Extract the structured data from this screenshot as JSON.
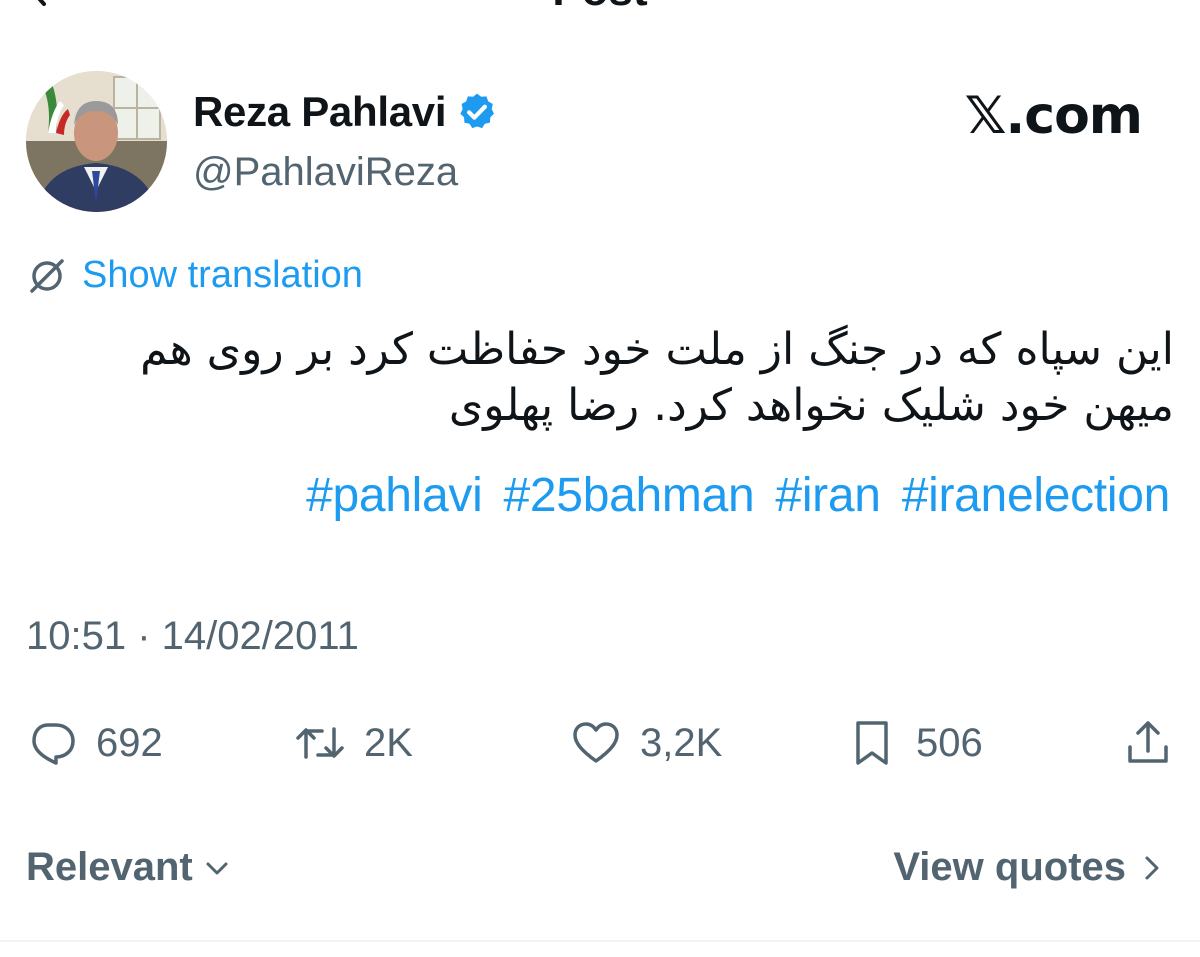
{
  "header": {
    "title": "Post"
  },
  "author": {
    "display_name": "Reza Pahlavi",
    "handle": "@PahlaviReza",
    "verified": true
  },
  "brand": {
    "label": "𝕏.com"
  },
  "translation": {
    "label": "Show translation"
  },
  "tweet": {
    "lines": [
      "این سپاه که در جنگ از ملت خود حفاظت کرد بر روی هم",
      "میهن خود شلیک نخواهد کرد.  رضا پهلوی"
    ],
    "hashtags": [
      "#pahlavi",
      "#25bahman",
      "#iran",
      "#iranelection"
    ]
  },
  "timestamp": "10:51 · 14/02/2011",
  "actions": {
    "replies": "692",
    "reposts": "2K",
    "likes": "3,2K",
    "bookmarks": "506"
  },
  "footer": {
    "sort_label": "Relevant",
    "quotes_label": "View quotes"
  },
  "colors": {
    "accent": "#1d9bf0",
    "muted": "#536471",
    "text": "#0f1419"
  },
  "icons": [
    "back-arrow-icon",
    "verified-badge-icon",
    "translate-icon",
    "reply-icon",
    "repost-icon",
    "like-icon",
    "bookmark-icon",
    "share-icon",
    "chevron-down-icon",
    "chevron-right-icon"
  ]
}
